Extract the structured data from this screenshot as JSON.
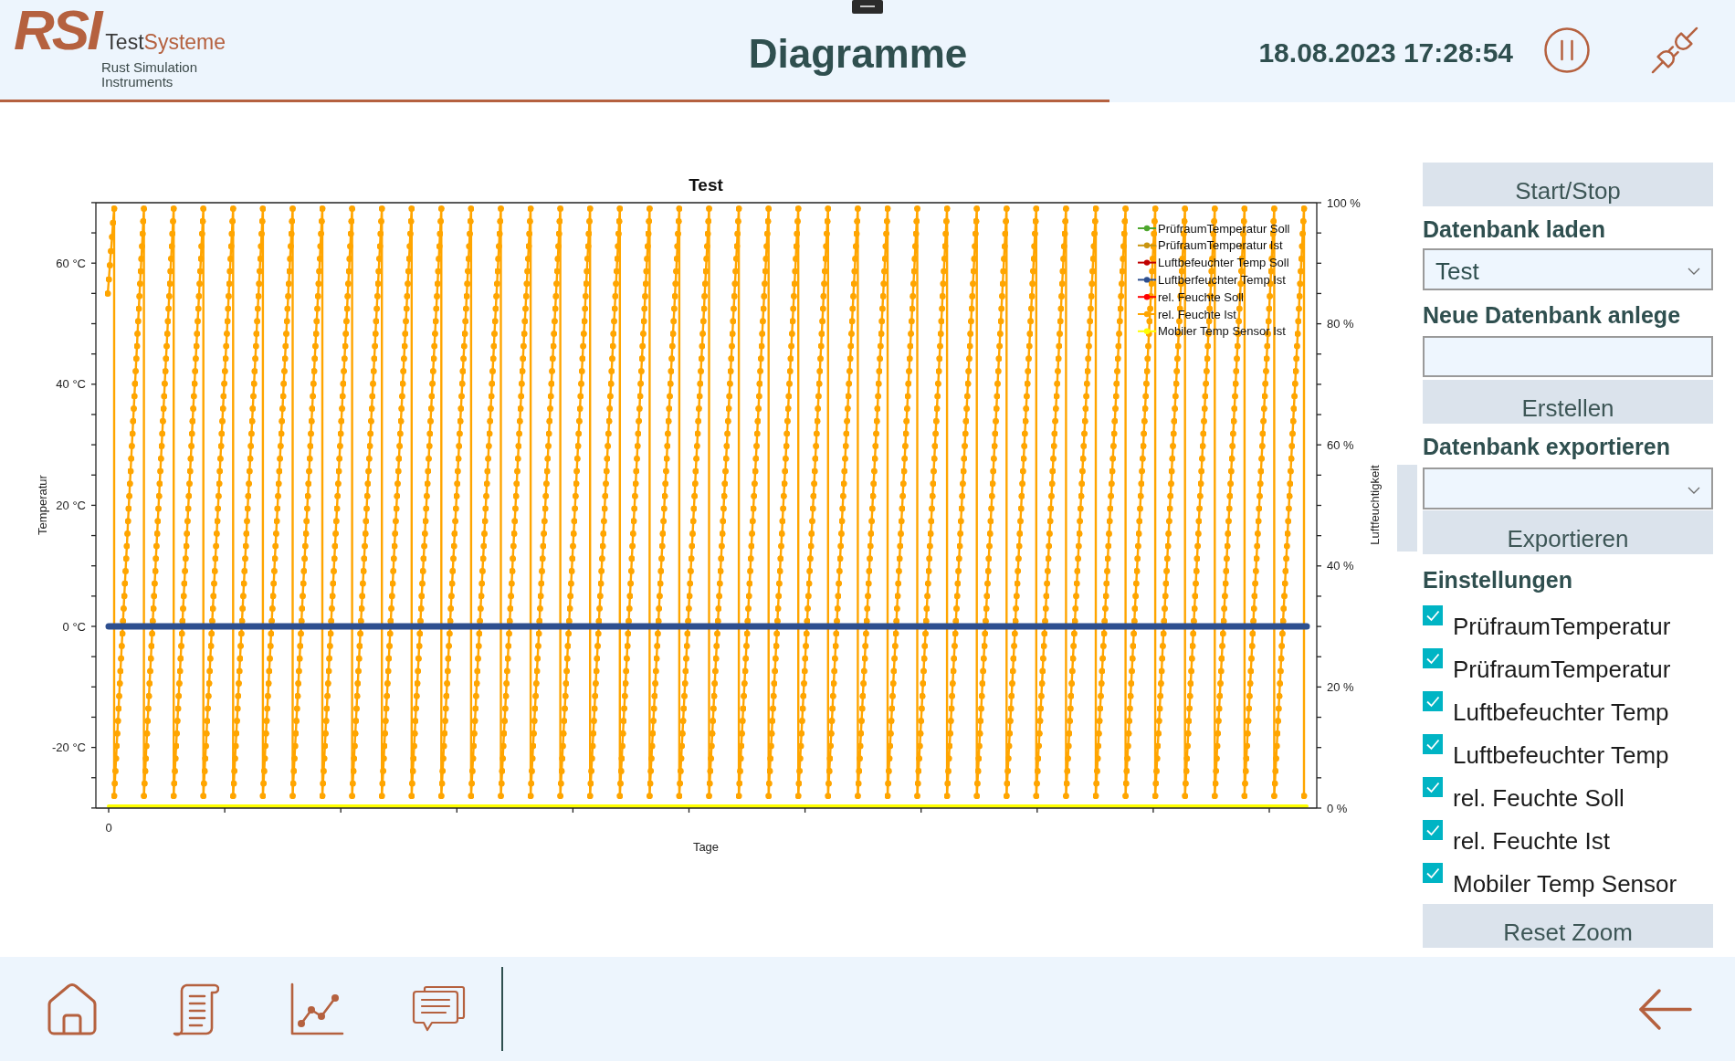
{
  "header": {
    "logo": {
      "mark": "RSI",
      "wordmark_parts": [
        "Test",
        "Systeme"
      ],
      "tagline": [
        "Rust Simulation",
        "Instruments"
      ]
    },
    "title": "Diagramme",
    "datetime": "18.08.2023 17:28:54"
  },
  "chart": {
    "title": "Test",
    "x_axis_label": "Tage",
    "x_tick_labels": [
      "0"
    ],
    "left_axis_label": "Temperatur",
    "left_tick_labels": [
      "60 °C",
      "40 °C",
      "20 °C",
      "0 °C",
      "-20 °C"
    ],
    "right_axis_label": "Luftfeuchtigkeit",
    "right_tick_labels": [
      "100 %",
      "80 %",
      "60 %",
      "40 %",
      "20 %",
      "0 %"
    ],
    "legend": [
      {
        "label": "PrüfraumTemperatur Soll",
        "color": "#4ea72e"
      },
      {
        "label": "PrüfraumTemperatur Ist",
        "color": "#c9950f"
      },
      {
        "label": "Luftbefeuchter Temp Soll",
        "color": "#c00000"
      },
      {
        "label": "Luftberfeuchter Temp Ist",
        "color": "#2e4f8f"
      },
      {
        "label": "rel. Feuchte Soll",
        "color": "#ff0000"
      },
      {
        "label": "rel. Feuchte Ist",
        "color": "#ffa500"
      },
      {
        "label": "Mobiler Temp Sensor Ist",
        "color": "#ffff00"
      }
    ]
  },
  "side_panel": {
    "start_stop_button": "Start/Stop",
    "load_label": "Datenbank laden",
    "load_dropdown": {
      "value": "Test"
    },
    "create_label": "Neue Datenbank anlege",
    "create_button": "Erstellen",
    "export_label": "Datenbank exportieren",
    "export_button": "Exportieren",
    "settings_label": "Einstellungen",
    "settings": [
      {
        "label": "PrüfraumTemperatur",
        "checked": true
      },
      {
        "label": "PrüfraumTemperatur",
        "checked": true
      },
      {
        "label": "Luftbefeuchter Temp",
        "checked": true
      },
      {
        "label": "Luftbefeuchter Temp",
        "checked": true
      },
      {
        "label": "rel. Feuchte Soll",
        "checked": true
      },
      {
        "label": "rel. Feuchte Ist",
        "checked": true
      },
      {
        "label": "Mobiler Temp Sensor",
        "checked": true
      }
    ],
    "reset_zoom_button": "Reset Zoom"
  }
}
